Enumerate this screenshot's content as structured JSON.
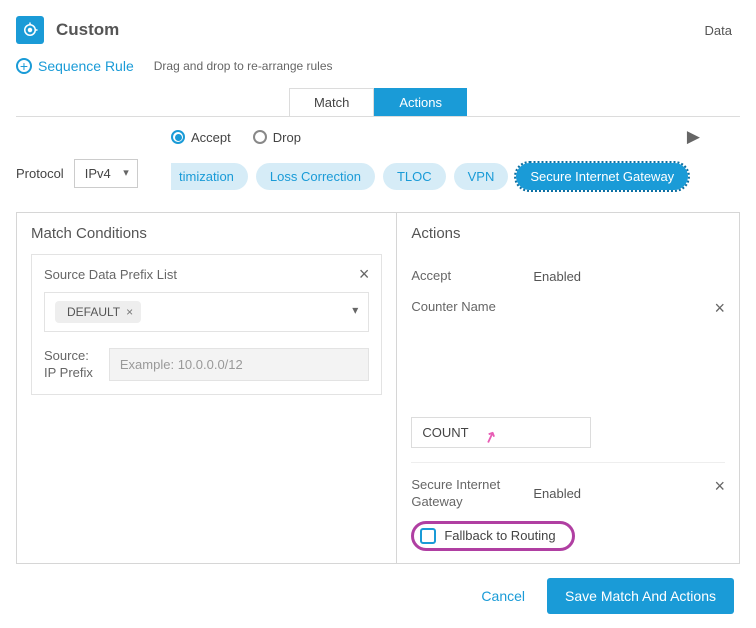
{
  "header": {
    "title": "Custom",
    "rightLabel": "Data"
  },
  "sequence": {
    "button": "Sequence Rule",
    "hint": "Drag and drop to re-arrange rules"
  },
  "tabs": {
    "match": "Match",
    "actions": "Actions"
  },
  "protocol": {
    "label": "Protocol",
    "value": "IPv4"
  },
  "radios": {
    "accept": "Accept",
    "drop": "Drop"
  },
  "pills": {
    "truncated": "timization",
    "loss": "Loss Correction",
    "tloc": "TLOC",
    "vpn": "VPN",
    "sig": "Secure Internet Gateway"
  },
  "matchPane": {
    "title": "Match Conditions",
    "prefixListLabel": "Source Data Prefix List",
    "chip": "DEFAULT",
    "sourceLabel1": "Source:",
    "sourceLabel2": "IP Prefix",
    "sourcePlaceholder": "Example: 10.0.0.0/12"
  },
  "actionsPane": {
    "title": "Actions",
    "accept": {
      "label": "Accept",
      "value": "Enabled"
    },
    "counter": {
      "label": "Counter Name",
      "value": "COUNT"
    },
    "sig": {
      "label": "Secure Internet Gateway",
      "value": "Enabled"
    },
    "fallback": "Fallback to Routing"
  },
  "footer": {
    "cancel": "Cancel",
    "save": "Save Match And Actions"
  }
}
